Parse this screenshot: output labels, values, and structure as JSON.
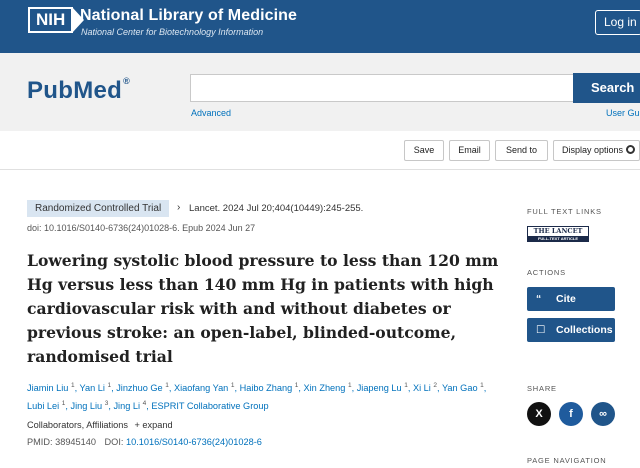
{
  "header": {
    "nih_logo": "NIH",
    "nih_title": "National Library of Medicine",
    "nih_subtitle": "National Center for Biotechnology Information",
    "login": "Log in"
  },
  "search": {
    "logo": "PubMed",
    "logo_mark": "®",
    "placeholder": "",
    "button": "Search",
    "advanced": "Advanced",
    "user_guide": "User Guide"
  },
  "actions": {
    "save": "Save",
    "email": "Email",
    "send_to": "Send to",
    "display_options": "Display options"
  },
  "article": {
    "type_badge": "Randomized Controlled Trial",
    "citation": "Lancet. 2024 Jul 20;404(10449):245-255.",
    "doi_line": "doi: 10.1016/S0140-6736(24)01028-6. Epub 2024 Jun 27",
    "title": "Lowering systolic blood pressure to less than 120 mm Hg versus less than 140 mm Hg in patients with high cardiovascular risk with and without diabetes or previous stroke: an open-label, blinded-outcome, randomised trial",
    "authors": [
      {
        "name": "Jiamin Liu",
        "sup": "1"
      },
      {
        "name": "Yan Li",
        "sup": "1"
      },
      {
        "name": "Jinzhuo Ge",
        "sup": "1"
      },
      {
        "name": "Xiaofang Yan",
        "sup": "1"
      },
      {
        "name": "Haibo Zhang",
        "sup": "1"
      },
      {
        "name": "Xin Zheng",
        "sup": "1"
      },
      {
        "name": "Jiapeng Lu",
        "sup": "1"
      },
      {
        "name": "Xi Li",
        "sup": "2"
      },
      {
        "name": "Yan Gao",
        "sup": "1"
      },
      {
        "name": "Lubi Lei",
        "sup": "1"
      },
      {
        "name": "Jing Liu",
        "sup": "3"
      },
      {
        "name": "Jing Li",
        "sup": "4"
      },
      {
        "name": "ESPRIT Collaborative Group",
        "sup": ""
      }
    ],
    "collaborators": "Collaborators, Affiliations",
    "expand": "+ expand",
    "pmid_label": "PMID:",
    "pmid": "38945140",
    "doi_label": "DOI:",
    "doi": "10.1016/S0140-6736(24)01028-6"
  },
  "sidebar": {
    "full_text_label": "FULL TEXT LINKS",
    "lancet_logo": "THE LANCET",
    "lancet_sub": "FULL-TEXT ARTICLE",
    "actions_label": "ACTIONS",
    "cite": "Cite",
    "cite_icon": "quote-icon",
    "collections": "Collections",
    "collections_icon": "bookmark-icon",
    "share_label": "SHARE",
    "share_x": "X",
    "share_facebook": "f",
    "share_link_icon": "link-icon",
    "page_nav_label": "PAGE NAVIGATION"
  },
  "colors": {
    "nih_blue": "#20558a",
    "link_blue": "#0071bc",
    "badge_bg": "#d9e5f1",
    "facebook": "#1f5b9d"
  }
}
